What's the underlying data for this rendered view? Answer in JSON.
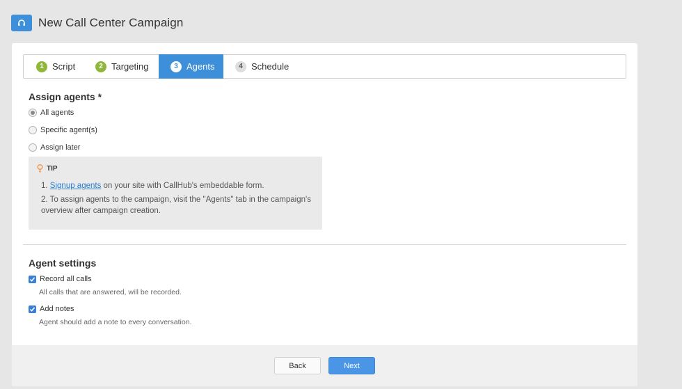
{
  "header": {
    "title": "New Call Center Campaign",
    "icon": "headset-icon"
  },
  "steps": [
    {
      "num": "1",
      "label": "Script",
      "state": "done"
    },
    {
      "num": "2",
      "label": "Targeting",
      "state": "done"
    },
    {
      "num": "3",
      "label": "Agents",
      "state": "active"
    },
    {
      "num": "4",
      "label": "Schedule",
      "state": "todo"
    }
  ],
  "assign": {
    "title": "Assign agents *",
    "options": [
      "All agents",
      "Specific agent(s)",
      "Assign later"
    ],
    "selected": "All agents"
  },
  "tip": {
    "label": "TIP",
    "item1_num": "1.",
    "item1_link": "Signup agents",
    "item1_rest": " on your site with CallHub's embeddable form.",
    "item2": "2. To assign agents to the campaign, visit the \"Agents\" tab in the campaign's overview after campaign creation."
  },
  "settings": {
    "title": "Agent settings",
    "record_label": "Record all calls",
    "record_hint": "All calls that are answered, will be recorded.",
    "record_checked": true,
    "notes_label": "Add notes",
    "notes_hint": "Agent should add a note to every conversation.",
    "notes_checked": true
  },
  "footer": {
    "back_label": "Back",
    "next_label": "Next"
  },
  "colors": {
    "accent": "#3d8fd9",
    "done": "#8fb83a"
  }
}
